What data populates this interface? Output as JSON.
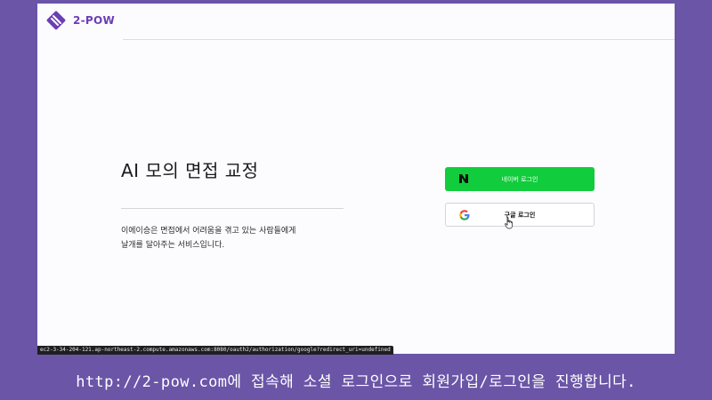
{
  "header": {
    "brand": "2-POW",
    "brand_color": "#6a3fb5"
  },
  "hero": {
    "title": "AI 모의 면접 교정",
    "description_line1": "이에이승은 면접에서 어려움을 겪고 있는 사람들에게",
    "description_line2": "날개를 달아주는 서비스입니다."
  },
  "auth": {
    "naver": {
      "label": "네이버 로그인",
      "icon": "naver-n-icon",
      "color": "#11cc3c"
    },
    "google": {
      "label": "구글 로그인",
      "icon": "google-g-icon",
      "color": "#ffffff"
    }
  },
  "status_bar": {
    "url": "ec2-3-34-204-121.ap-northeast-2.compute.amazonaws.com:8080/oauth2/authorization/google?redirect_uri=undefined"
  },
  "caption": {
    "text": "http://2-pow.com에 접속해 소셜 로그인으로 회원가입/로그인을 진행합니다."
  },
  "colors": {
    "page_bg": "#6a55a7",
    "window_bg": "#fcfbfd"
  }
}
